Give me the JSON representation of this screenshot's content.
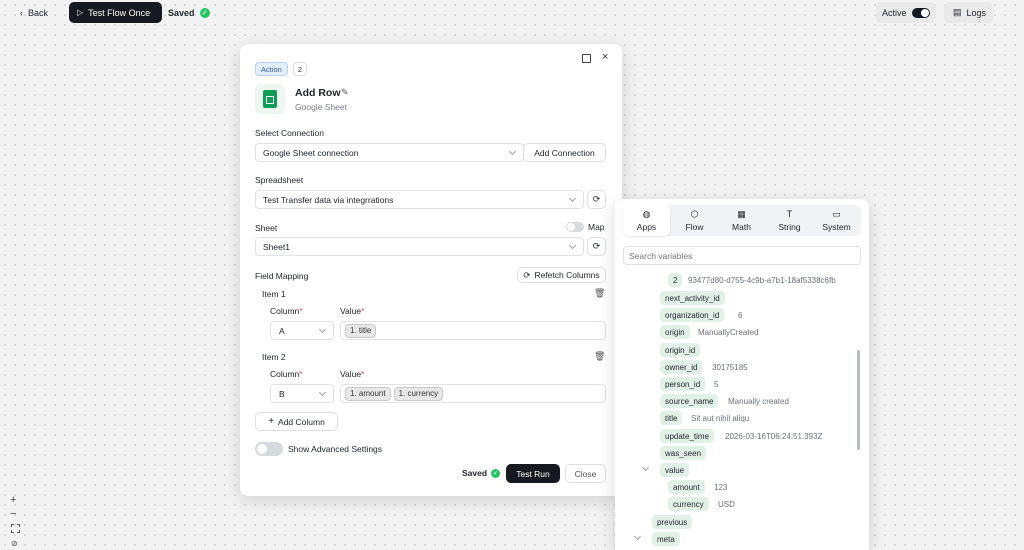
{
  "topbar": {
    "back_label": "Back",
    "test_flow_label": "Test Flow Once",
    "saved_label": "Saved",
    "active_label": "Active",
    "logs_label": "Logs"
  },
  "panel": {
    "badge_action": "Action",
    "badge_step": "2",
    "title": "Add Row",
    "subtitle": "Google Sheet",
    "select_connection_label": "Select Connection",
    "connection_value": "Google Sheet connection",
    "add_connection_label": "Add Connection",
    "spreadsheet_label": "Spreadsheet",
    "spreadsheet_value": "Test Transfer data via integrrations",
    "sheet_label": "Sheet",
    "map_label": "Map",
    "sheet_value": "Sheet1",
    "field_mapping_label": "Field Mapping",
    "refetch_label": "Refetch Columns",
    "column_label": "Column",
    "value_label": "Value",
    "required_mark": "*",
    "items": [
      {
        "label": "Item 1",
        "column": "A",
        "chips": [
          "1. title"
        ]
      },
      {
        "label": "Item 2",
        "column": "B",
        "chips": [
          "1. amount",
          "1. currency"
        ]
      }
    ],
    "add_column_label": "Add Column",
    "advanced_label": "Show Advanced Settings",
    "saved_label": "Saved",
    "test_run_label": "Test Run",
    "close_label": "Close"
  },
  "variables": {
    "tabs": [
      {
        "label": "Apps",
        "icon": "globe-icon",
        "glyph": "◍"
      },
      {
        "label": "Flow",
        "icon": "cube-icon",
        "glyph": "⬡"
      },
      {
        "label": "Math",
        "icon": "calculator-icon",
        "glyph": "▦"
      },
      {
        "label": "String",
        "icon": "text-icon",
        "glyph": "T"
      },
      {
        "label": "System",
        "icon": "monitor-icon",
        "glyph": "▭"
      }
    ],
    "search_placeholder": "Search variables",
    "rows": [
      {
        "key": "2",
        "value": "93477d80-d755-4c9b-a7b1-18af5338c6fb"
      },
      {
        "key": "next_activity_id",
        "value": ""
      },
      {
        "key": "organization_id",
        "value": "6"
      },
      {
        "key": "origin",
        "value": "ManuallyCreated"
      },
      {
        "key": "origin_id",
        "value": ""
      },
      {
        "key": "owner_id",
        "value": "30175185"
      },
      {
        "key": "person_id",
        "value": "5"
      },
      {
        "key": "source_name",
        "value": "Manually created"
      },
      {
        "key": "title",
        "value": "Sit aut nihil aliqu"
      },
      {
        "key": "update_time",
        "value": "2026-03-16T06:24:51.393Z"
      },
      {
        "key": "was_seen",
        "value": ""
      },
      {
        "key": "value",
        "value": ""
      },
      {
        "key": "amount",
        "value": "123"
      },
      {
        "key": "currency",
        "value": "USD"
      },
      {
        "key": "previous",
        "value": ""
      },
      {
        "key": "meta",
        "value": ""
      }
    ]
  },
  "colors": {
    "accent_green": "#22c55e",
    "chip_green": "#e2f1e7",
    "dark_button": "#161a20"
  }
}
